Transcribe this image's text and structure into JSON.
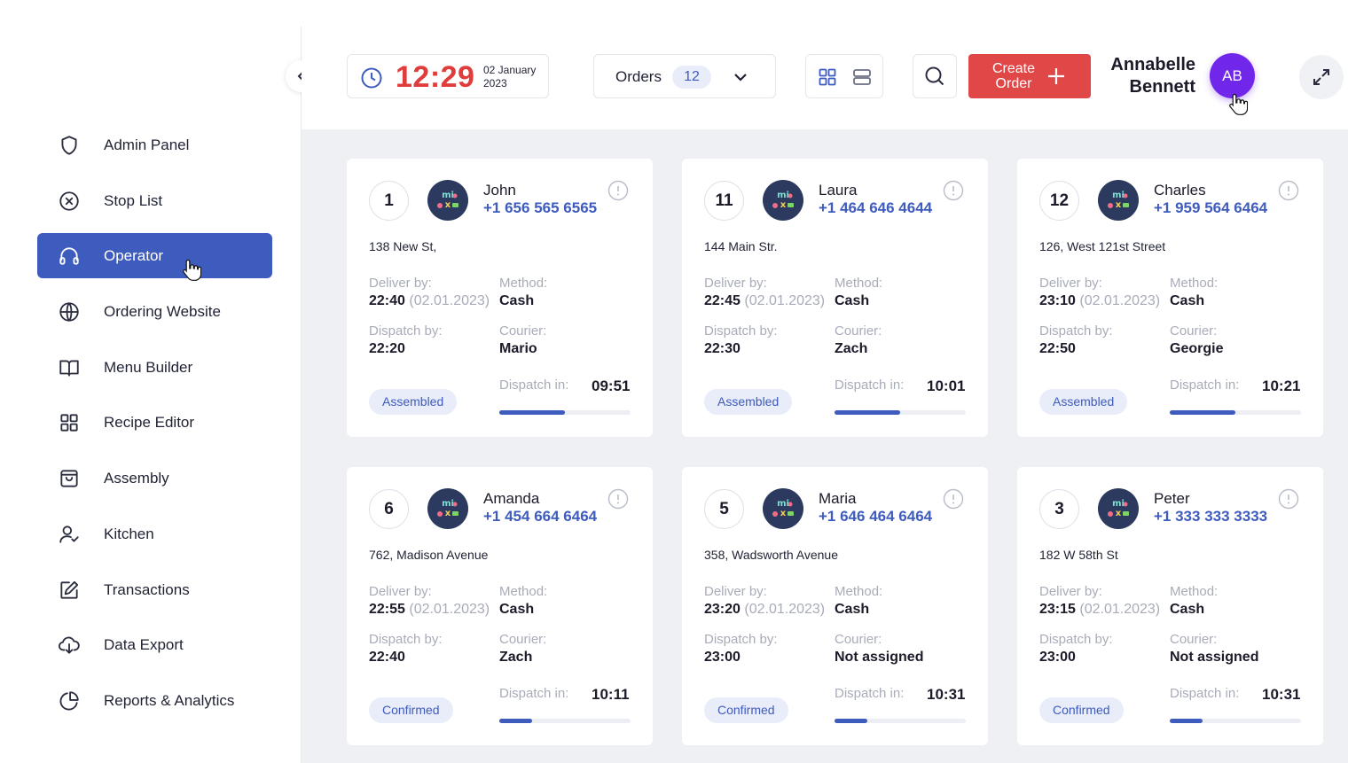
{
  "sidebar": {
    "items": [
      {
        "label": "Admin Panel",
        "icon": "shield-icon",
        "active": false
      },
      {
        "label": "Stop List",
        "icon": "x-circle-icon",
        "active": false
      },
      {
        "label": "Operator",
        "icon": "headphones-icon",
        "active": true
      },
      {
        "label": "Ordering Website",
        "icon": "globe-icon",
        "active": false
      },
      {
        "label": "Menu Builder",
        "icon": "book-icon",
        "active": false
      },
      {
        "label": "Recipe Editor",
        "icon": "grid-icon",
        "active": false
      },
      {
        "label": "Assembly",
        "icon": "bag-icon",
        "active": false
      },
      {
        "label": "Kitchen",
        "icon": "user-check-icon",
        "active": false
      },
      {
        "label": "Transactions",
        "icon": "edit-icon",
        "active": false
      },
      {
        "label": "Data Export",
        "icon": "cloud-download-icon",
        "active": false
      },
      {
        "label": "Reports & Analytics",
        "icon": "pie-chart-icon",
        "active": false
      }
    ]
  },
  "header": {
    "time": "12:29",
    "date": "02 January 2023",
    "orders_label": "Orders",
    "orders_count": "12",
    "create_order_label": "Create Order",
    "user_name": "Annabelle Bennett",
    "user_initials": "AB"
  },
  "labels": {
    "deliver_by": "Deliver by:",
    "method": "Method:",
    "dispatch_by": "Dispatch by:",
    "courier": "Courier:",
    "dispatch_in": "Dispatch in:"
  },
  "colors": {
    "accent": "#3e5bbe",
    "danger": "#e04848",
    "clock": "#e03c3c",
    "avatar": "#7127ea",
    "background": "#eff0f4"
  },
  "orders": [
    {
      "number": "1",
      "name": "John",
      "phone": "+1 656 565 6565",
      "address": "138 New St,",
      "deliver_time": "22:40",
      "deliver_date": "(02.01.2023)",
      "method": "Cash",
      "dispatch_time": "22:20",
      "courier": "Mario",
      "status": "Assembled",
      "dispatch_in": "09:51",
      "progress": 0.5
    },
    {
      "number": "11",
      "name": "Laura",
      "phone": "+1 464 646 4644",
      "address": "144 Main Str.",
      "deliver_time": "22:45",
      "deliver_date": "(02.01.2023)",
      "method": "Cash",
      "dispatch_time": "22:30",
      "courier": "Zach",
      "status": "Assembled",
      "dispatch_in": "10:01",
      "progress": 0.5
    },
    {
      "number": "12",
      "name": "Charles",
      "phone": "+1 959 564 6464",
      "address": "126, West 121st Street",
      "deliver_time": "23:10",
      "deliver_date": "(02.01.2023)",
      "method": "Cash",
      "dispatch_time": "22:50",
      "courier": "Georgie",
      "status": "Assembled",
      "dispatch_in": "10:21",
      "progress": 0.5
    },
    {
      "number": "6",
      "name": "Amanda",
      "phone": "+1 454 664 6464",
      "address": "762, Madison Avenue",
      "deliver_time": "22:55",
      "deliver_date": "(02.01.2023)",
      "method": "Cash",
      "dispatch_time": "22:40",
      "courier": "Zach",
      "status": "Confirmed",
      "dispatch_in": "10:11",
      "progress": 0.25
    },
    {
      "number": "5",
      "name": "Maria",
      "phone": "+1 646 464 6464",
      "address": "358, Wadsworth Avenue",
      "deliver_time": "23:20",
      "deliver_date": "(02.01.2023)",
      "method": "Cash",
      "dispatch_time": "23:00",
      "courier": "Not assigned",
      "status": "Confirmed",
      "dispatch_in": "10:31",
      "progress": 0.25
    },
    {
      "number": "3",
      "name": "Peter",
      "phone": "+1 333 333 3333",
      "address": "182 W 58th St",
      "deliver_time": "23:15",
      "deliver_date": "(02.01.2023)",
      "method": "Cash",
      "dispatch_time": "23:00",
      "courier": "Not assigned",
      "status": "Confirmed",
      "dispatch_in": "10:31",
      "progress": 0.25
    }
  ]
}
